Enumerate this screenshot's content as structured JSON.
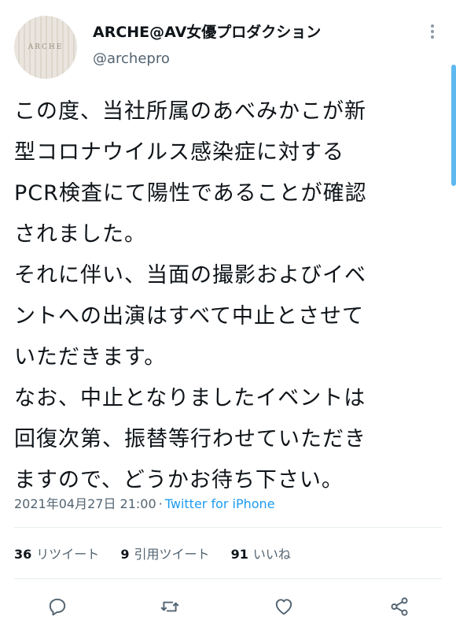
{
  "account": {
    "display_name": "ARCHE@AV女優プロダクション",
    "handle": "@archepro",
    "avatar_text": "ARCHE"
  },
  "tweet": {
    "lines": [
      "この度、当社所属のあべみかこが新",
      "型コロナウイルス感染症に対する",
      "PCR検査にて陽性であることが確認",
      "されました。",
      "それに伴い、当面の撮影およびイベ",
      "ントへの出演はすべて中止とさせて",
      "いただきます。",
      "なお、中止となりましたイベントは",
      "回復次第、振替等行わせていただき",
      "ますので、どうかお待ち下さい。"
    ],
    "timestamp": "2021年04月27日 21:00",
    "separator": "·",
    "source": "Twitter for iPhone"
  },
  "stats": {
    "retweets": {
      "count": "36",
      "label": "リツイート"
    },
    "quotes": {
      "count": "9",
      "label": "引用ツイート"
    },
    "likes": {
      "count": "91",
      "label": "いいね"
    }
  },
  "icons": {
    "reply": "reply-icon",
    "retweet": "retweet-icon",
    "like": "heart-icon",
    "share": "share-icon",
    "more": "more-vertical-icon"
  },
  "colors": {
    "text": "#0f1419",
    "secondary": "#536471",
    "link": "#1d9bf0",
    "divider": "#e6ecf0",
    "scrollbar": "#5fb9f1"
  }
}
